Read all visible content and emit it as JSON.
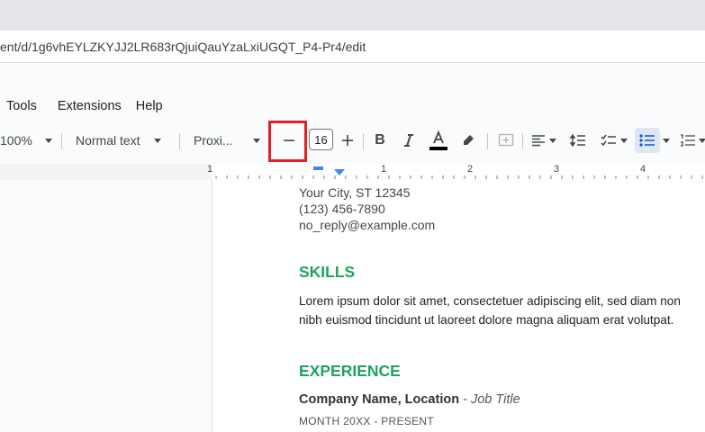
{
  "browser": {
    "url": "ent/d/1g6vhEYLZKYJJ2LR683rQjuiQauYzaLxiUGQT_P4-Pr4/edit"
  },
  "menu": {
    "items": [
      "Tools",
      "Extensions",
      "Help"
    ]
  },
  "toolbar": {
    "zoom": "100%",
    "style": "Normal text",
    "font": "Proxi...",
    "font_size": "16",
    "decrease_icon": "minus-icon",
    "increase_icon": "plus-icon"
  },
  "ruler": {
    "labels": [
      "1",
      "1",
      "2",
      "3",
      "4"
    ]
  },
  "document": {
    "address_line": "Your City, ST 12345",
    "phone": "(123) 456-7890",
    "email": "no_reply@example.com",
    "skills_heading": "SKILLS",
    "skills_line1": "Lorem ipsum dolor sit amet, consectetuer adipiscing elit, sed diam non",
    "skills_line2": "nibh euismod tincidunt ut laoreet dolore magna aliquam erat volutpat.",
    "experience_heading": "EXPERIENCE",
    "company": "Company Name,",
    "location": "Location",
    "job_separator": " - ",
    "job_title": "Job Title",
    "dates": "MONTH 20XX - PRESENT"
  },
  "colors": {
    "heading_green": "#1ea362",
    "highlight_red": "#e1212a",
    "ruler_blue": "#4285f4"
  }
}
